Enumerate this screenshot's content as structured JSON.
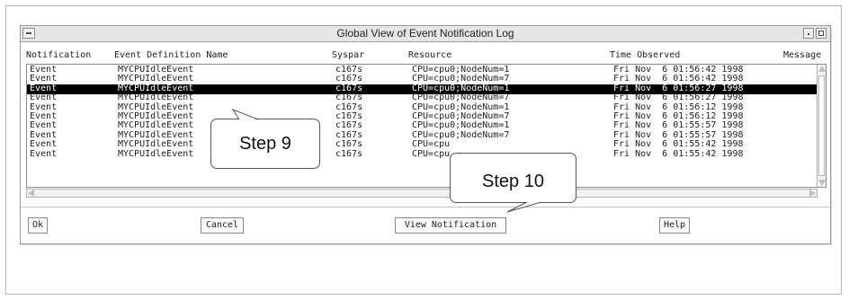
{
  "window": {
    "title": "Global View of Event Notification Log"
  },
  "columns": {
    "notification": "Notification",
    "event_definition_name": "Event Definition Name",
    "syspar": "Syspar",
    "resource": "Resource",
    "time_observed": "Time Observed",
    "message": "Message"
  },
  "rows": [
    {
      "notification": "Event",
      "event": "MYCPUIdleEvent",
      "syspar": "c167s",
      "resource": "CPU=cpu0;NodeNum=1",
      "time": "Fri Nov  6 01:56:42 1998",
      "selected": false
    },
    {
      "notification": "Event",
      "event": "MYCPUIdleEvent",
      "syspar": "c167s",
      "resource": "CPU=cpu0;NodeNum=7",
      "time": "Fri Nov  6 01:56:42 1998",
      "selected": false
    },
    {
      "notification": "Event",
      "event": "MYCPUIdleEvent",
      "syspar": "c167s",
      "resource": "CPU=cpu0;NodeNum=1",
      "time": "Fri Nov  6 01:56:27 1998",
      "selected": true
    },
    {
      "notification": "Event",
      "event": "MYCPUIdleEvent",
      "syspar": "c167s",
      "resource": "CPU=cpu0;NodeNum=7",
      "time": "Fri Nov  6 01:56:27 1998",
      "selected": false
    },
    {
      "notification": "Event",
      "event": "MYCPUIdleEvent",
      "syspar": "c167s",
      "resource": "CPU=cpu0;NodeNum=1",
      "time": "Fri Nov  6 01:56:12 1998",
      "selected": false
    },
    {
      "notification": "Event",
      "event": "MYCPUIdleEvent",
      "syspar": "c167s",
      "resource": "CPU=cpu0;NodeNum=7",
      "time": "Fri Nov  6 01:56:12 1998",
      "selected": false
    },
    {
      "notification": "Event",
      "event": "MYCPUIdleEvent",
      "syspar": "c167s",
      "resource": "CPU=cpu0;NodeNum=1",
      "time": "Fri Nov  6 01:55:57 1998",
      "selected": false
    },
    {
      "notification": "Event",
      "event": "MYCPUIdleEvent",
      "syspar": "c167s",
      "resource": "CPU=cpu0;NodeNum=7",
      "time": "Fri Nov  6 01:55:57 1998",
      "selected": false
    },
    {
      "notification": "Event",
      "event": "MYCPUIdleEvent",
      "syspar": "c167s",
      "resource": "CPU=cpu",
      "time": "Fri Nov  6 01:55:42 1998",
      "selected": false
    },
    {
      "notification": "Event",
      "event": "MYCPUIdleEvent",
      "syspar": "c167s",
      "resource": "CPU=cpu",
      "time": "Fri Nov  6 01:55:42 1998",
      "selected": false
    }
  ],
  "buttons": {
    "ok": "Ok",
    "cancel": "Cancel",
    "view_notification": "View Notification",
    "help": "Help"
  },
  "annotations": {
    "step9": "Step 9",
    "step10": "Step 10"
  },
  "colors": {
    "selection_bg": "#000000",
    "selection_fg": "#ffffff",
    "titlebar_bg": "#e6e6e6"
  },
  "icons": [
    "window-menu-icon",
    "minimize-icon",
    "maximize-icon",
    "scroll-up-icon",
    "scroll-down-icon",
    "scroll-left-icon",
    "scroll-right-icon"
  ]
}
